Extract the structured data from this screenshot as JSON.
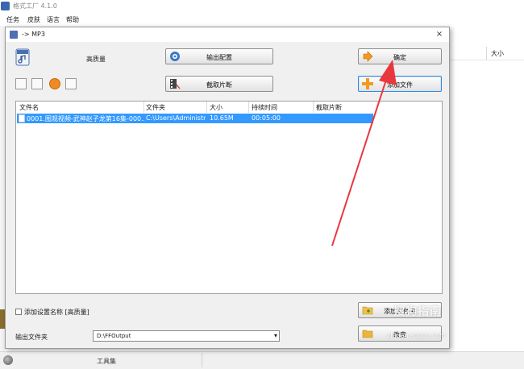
{
  "main_window": {
    "title": "格式工厂 4.1.0",
    "menu": [
      "任务",
      "皮肤",
      "语言",
      "帮助"
    ],
    "right_panel_column": "大小",
    "statusbar_text": "工具集"
  },
  "dialog": {
    "title": "-> MP3",
    "close_glyph": "×",
    "quality_label": "高质量",
    "buttons": {
      "output_settings": "输出配置",
      "clip": "截取片断",
      "ok": "确定",
      "add_file": "添加文件",
      "add_folder": "添加文件夹",
      "change": "改变"
    },
    "table": {
      "headers": [
        "文件名",
        "文件夹",
        "大小",
        "持续时间",
        "截取片断"
      ],
      "rows": [
        {
          "filename": "0001.图观视频-武神赵子龙第16集-000...",
          "folder": "C:\\Users\\Administr...",
          "size": "10.65M",
          "duration": "00:05:00",
          "clip": ""
        }
      ]
    },
    "append_setting_label": "添加设置名称 [高质量]",
    "append_setting_checked": false,
    "output_folder_label": "输出文件夹",
    "output_folder_value": "D:\\FFOutput"
  },
  "watermark": {
    "text": "搜狗指南",
    "url": "zhinan.sogou.com"
  },
  "colors": {
    "selection": "#3399ff",
    "annotation_arrow": "#e8383d",
    "dialog_bg": "#f0f0f0"
  },
  "icons": {
    "app": "format-factory-icon",
    "output_settings": "settings-disc-icon",
    "clip": "film-cut-icon",
    "ok": "arrow-right-icon",
    "add_file": "plus-icon",
    "add_folder": "folder-add-icon",
    "change": "folder-icon"
  }
}
